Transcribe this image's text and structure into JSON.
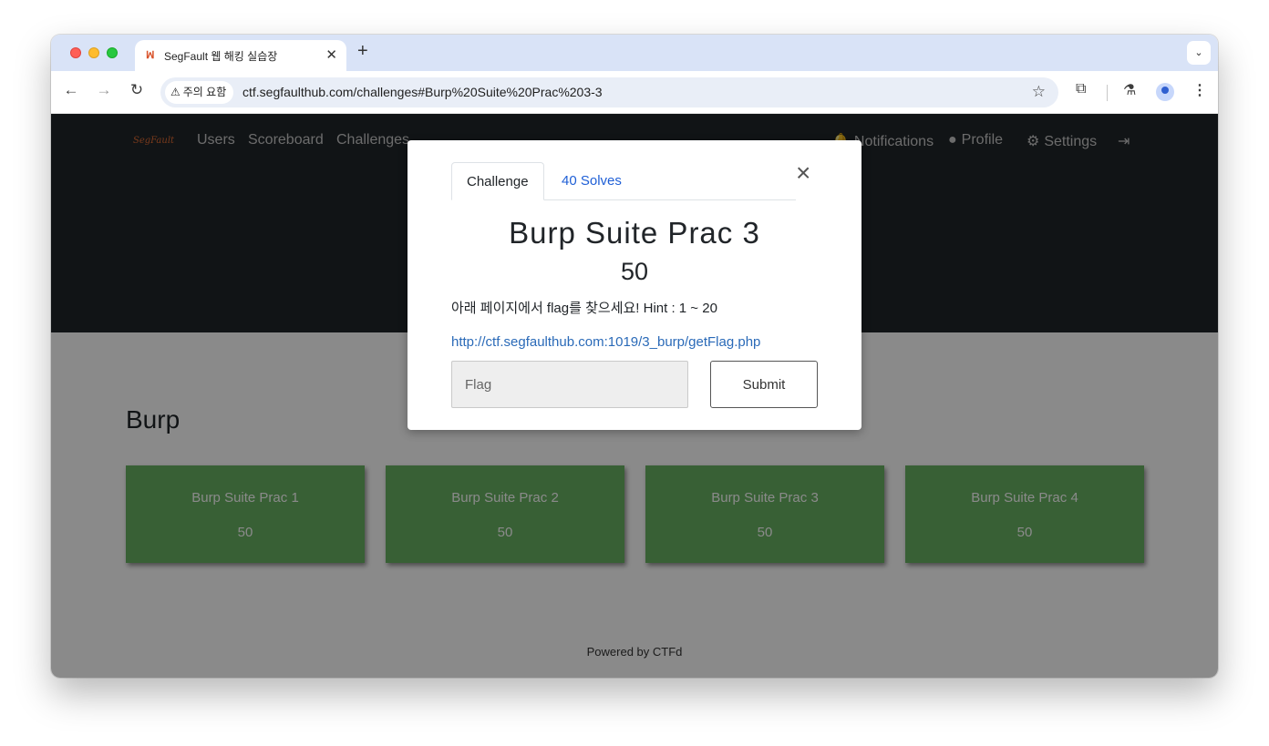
{
  "browser": {
    "tab_title": "SegFault 웹 해킹 실습장",
    "tab_favicon": "ꟽ",
    "new_tab_glyph": "+",
    "tab_close_glyph": "✕",
    "tab_menu_glyph": "⌄",
    "warning_label": "주의 요함",
    "url": "ctf.segfaulthub.com/challenges#Burp%20Suite%20Prac%203-3"
  },
  "site": {
    "logo_text": "SegFault",
    "nav": {
      "users": "Users",
      "scoreboard": "Scoreboard",
      "challenges": "Challenges",
      "notifications": "Notifications",
      "profile": "Profile",
      "settings": "Settings"
    },
    "category": "Burp",
    "cards": [
      {
        "name": "Burp Suite Prac 1",
        "value": "50"
      },
      {
        "name": "Burp Suite Prac 2",
        "value": "50"
      },
      {
        "name": "Burp Suite Prac 3",
        "value": "50"
      },
      {
        "name": "Burp Suite Prac 4",
        "value": "50"
      }
    ],
    "footer": "Powered by CTFd"
  },
  "modal": {
    "tab_challenge": "Challenge",
    "tab_solves": "40 Solves",
    "title": "Burp Suite Prac 3",
    "value": "50",
    "description": "아래 페이지에서 flag를 찾으세요! Hint : 1 ~ 20",
    "link": "http://ctf.segfaulthub.com:1019/3_burp/getFlag.php",
    "flag_placeholder": "Flag",
    "submit_label": "Submit"
  },
  "colors": {
    "card_green": "#68b262",
    "hero_dark": "#212529",
    "tabstrip": "#d9e3f7",
    "link_blue": "#1f5fd6"
  },
  "icons": [
    "back-icon",
    "forward-icon",
    "reload-icon",
    "warning-icon",
    "star-icon",
    "extensions-icon",
    "labs-icon",
    "profile-avatar-icon",
    "menu-icon",
    "bell-icon",
    "user-circle-icon",
    "gears-icon",
    "logout-icon",
    "close-icon"
  ]
}
